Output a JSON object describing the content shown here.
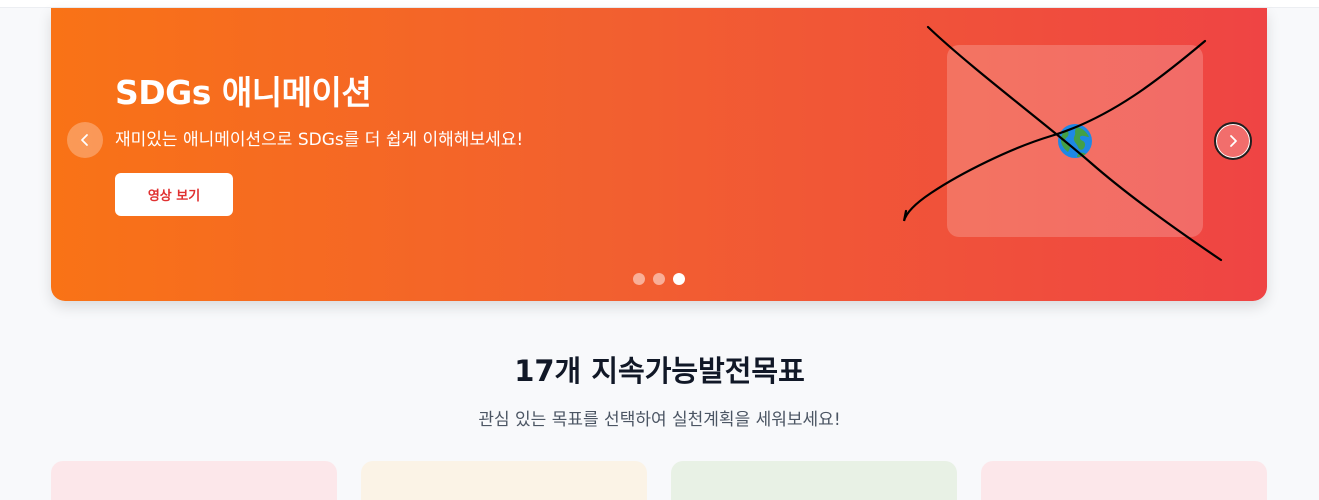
{
  "banner": {
    "title": "SDGs 애니메이션",
    "subtitle": "재미있는 애니메이션으로 SDGs를 더 쉽게 이해해보세요!",
    "button_label": "영상 보기",
    "media_icon": "globe-emoji",
    "prev_icon": "chevron-left-icon",
    "next_icon": "chevron-right-icon",
    "slides_total": 3,
    "active_slide": 3,
    "gradient_start": "#f97316",
    "gradient_end": "#ef4444",
    "button_text_color": "#e03131"
  },
  "goals_section": {
    "title": "17개 지속가능발전목표",
    "subtitle": "관심 있는 목표를 선택하여 실천계획을 세워보세요!",
    "cards": [
      {
        "color": "#fce7ea"
      },
      {
        "color": "#fbf3e6"
      },
      {
        "color": "#e8f1e5"
      },
      {
        "color": "#fce7ea"
      }
    ]
  }
}
